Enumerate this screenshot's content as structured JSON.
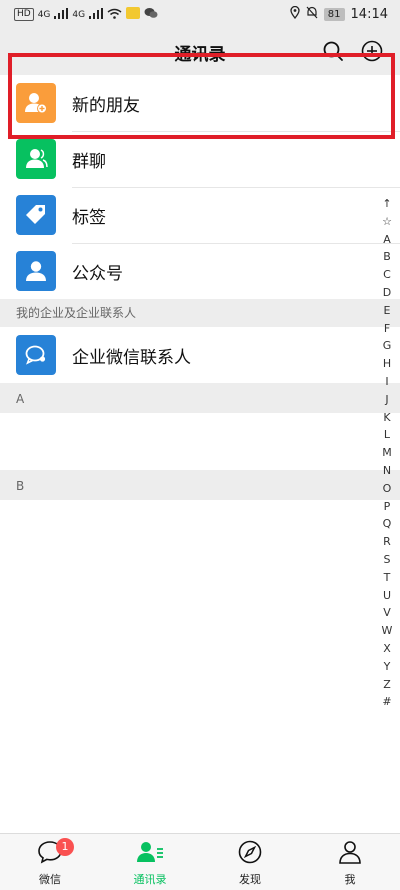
{
  "status_bar": {
    "left_chips": [
      "HD",
      "4G",
      "4G"
    ],
    "time": "14:14",
    "battery": "81"
  },
  "nav": {
    "title": "通讯录",
    "search_icon": "search-icon",
    "add_icon": "plus-circle-icon"
  },
  "fixed_items": [
    {
      "label": "新的朋友",
      "icon": "add-friend-icon",
      "color": "#fa9d3b"
    },
    {
      "label": "群聊",
      "icon": "group-icon",
      "color": "#07c160"
    },
    {
      "label": "标签",
      "icon": "tag-icon",
      "color": "#2782d7"
    },
    {
      "label": "公众号",
      "icon": "official-account-icon",
      "color": "#2782d7"
    }
  ],
  "enterprise_section": {
    "header": "我的企业及企业联系人",
    "item_label": "企业微信联系人",
    "item_icon": "enterprise-chat-icon",
    "item_color": "#2782d7"
  },
  "letter_sections": [
    "A",
    "B"
  ],
  "alpha_index": [
    "↑",
    "☆",
    "A",
    "B",
    "C",
    "D",
    "E",
    "F",
    "G",
    "H",
    "I",
    "J",
    "K",
    "L",
    "M",
    "N",
    "O",
    "P",
    "Q",
    "R",
    "S",
    "T",
    "U",
    "V",
    "W",
    "X",
    "Y",
    "Z",
    "#"
  ],
  "tabs": [
    {
      "label": "微信",
      "icon": "chat-icon",
      "badge": "1"
    },
    {
      "label": "通讯录",
      "icon": "contacts-icon"
    },
    {
      "label": "发现",
      "icon": "compass-icon"
    },
    {
      "label": "我",
      "icon": "user-icon"
    }
  ],
  "colors": {
    "accent": "#07c160",
    "highlight_border": "#e01e28",
    "badge": "#fa5151"
  }
}
